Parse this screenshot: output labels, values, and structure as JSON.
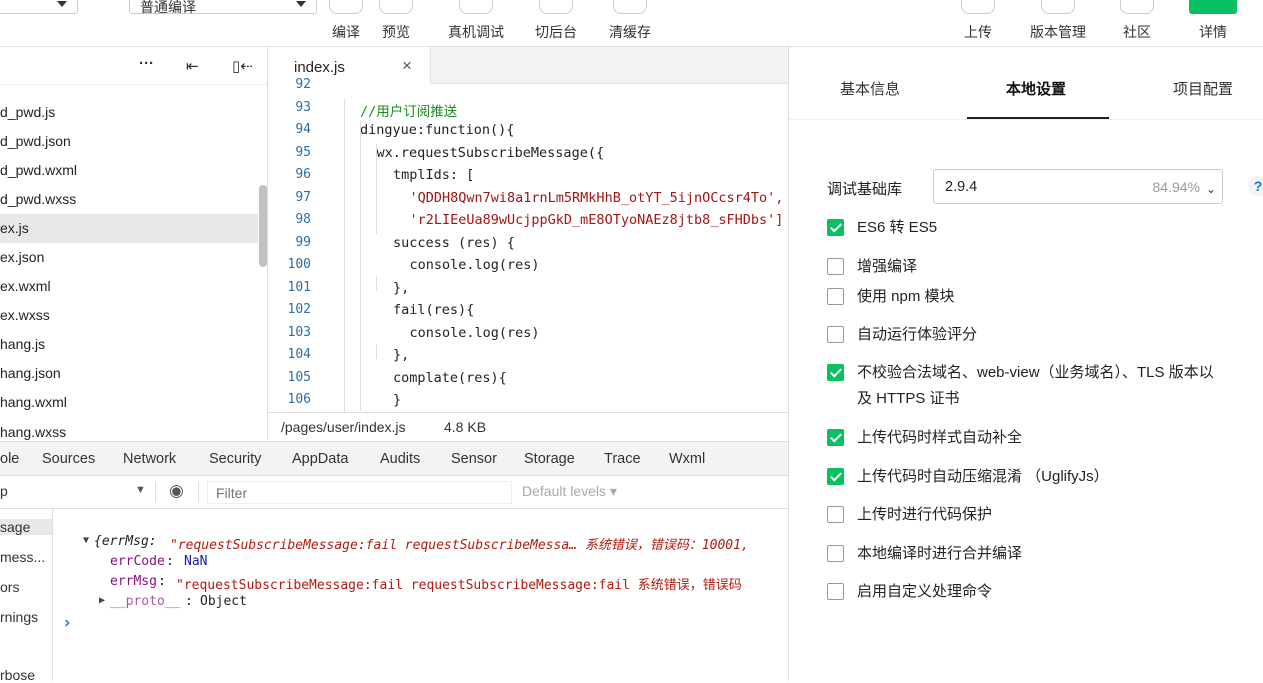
{
  "toolbar": {
    "mode_select": "普通编译",
    "compile": "编译",
    "preview": "预览",
    "device_debug": "真机调试",
    "switch_bg": "切后台",
    "clear_cache": "清缓存",
    "upload": "上传",
    "version": "版本管理",
    "community": "社区",
    "details": "详情"
  },
  "filetree": {
    "more": "···",
    "files": [
      "d_pwd.js",
      "d_pwd.json",
      "d_pwd.wxml",
      "d_pwd.wxss",
      "ex.js",
      "ex.json",
      "ex.wxml",
      "ex.wxss",
      "hang.js",
      "hang.json",
      "hang.wxml",
      "hang.wxss"
    ]
  },
  "editor": {
    "tab": "index.js",
    "close": "×",
    "lines": [
      {
        "n": "92",
        "t": ""
      },
      {
        "n": "93",
        "t": "//用户订阅推送"
      },
      {
        "n": "94",
        "t": "dingyue:function(){"
      },
      {
        "n": "95",
        "t": "wx.requestSubscribeMessage({"
      },
      {
        "n": "96",
        "t": "tmplIds: ["
      },
      {
        "n": "97",
        "t": "'QDDH8Qwn7wi8a1rnLm5RMkHhB_otYT_5ijnOCcsr4To',"
      },
      {
        "n": "98",
        "t": "'r2LIEeUa89wUcjppGkD_mE8OTyoNAEz8jtb8_sFHDbs']"
      },
      {
        "n": "99",
        "t": "success (res) {"
      },
      {
        "n": "100",
        "t": "console.log(res)"
      },
      {
        "n": "101",
        "t": "},"
      },
      {
        "n": "102",
        "t": "fail(res){"
      },
      {
        "n": "103",
        "t": "console.log(res)"
      },
      {
        "n": "104",
        "t": "},"
      },
      {
        "n": "105",
        "t": "complate(res){"
      },
      {
        "n": "106",
        "t": "}"
      }
    ],
    "status_path": "/pages/user/index.js",
    "status_size": "4.8 KB"
  },
  "devtools": {
    "tabs": [
      "ole",
      "Sources",
      "Network",
      "Security",
      "AppData",
      "Audits",
      "Sensor",
      "Storage",
      "Trace",
      "Wxml"
    ],
    "context": "p",
    "filter_placeholder": "Filter",
    "levels": "Default levels",
    "sidebar": [
      "sage",
      "mess...",
      "ors",
      "rnings",
      "rbose"
    ],
    "log_line1_prefix": "{errMsg: ",
    "log_line1_msg": "\"requestSubscribeMessage:fail requestSubscribeMessa… 系统错误，错误码：10001,",
    "errcode_key": "errCode",
    "errcode_val": "NaN",
    "errmsg_key": "errMsg",
    "errmsg_val": "\"requestSubscribeMessage:fail requestSubscribeMessage:fail 系统错误，错误码",
    "proto_key": "__proto__",
    "proto_val": "Object",
    "prompt": "›"
  },
  "rpanel": {
    "tabs": [
      "基本信息",
      "本地设置",
      "项目配置"
    ],
    "base_label": "调试基础库",
    "base_version": "2.9.4",
    "base_percent": "84.94%",
    "help": "?",
    "options": [
      {
        "label": "ES6 转 ES5",
        "checked": true
      },
      {
        "label": "增强编译",
        "checked": false
      },
      {
        "label": "使用 npm 模块",
        "checked": false
      },
      {
        "label": "自动运行体验评分",
        "checked": false
      },
      {
        "label": "不校验合法域名、web-view（业务域名）、TLS 版本以及 HTTPS 证书",
        "checked": true
      },
      {
        "label": "上传代码时样式自动补全",
        "checked": true
      },
      {
        "label": "上传代码时自动压缩混淆 （UglifyJs）",
        "checked": true
      },
      {
        "label": "上传时进行代码保护",
        "checked": false
      },
      {
        "label": "本地编译时进行合并编译",
        "checked": false
      },
      {
        "label": "启用自定义处理命令",
        "checked": false
      }
    ]
  }
}
